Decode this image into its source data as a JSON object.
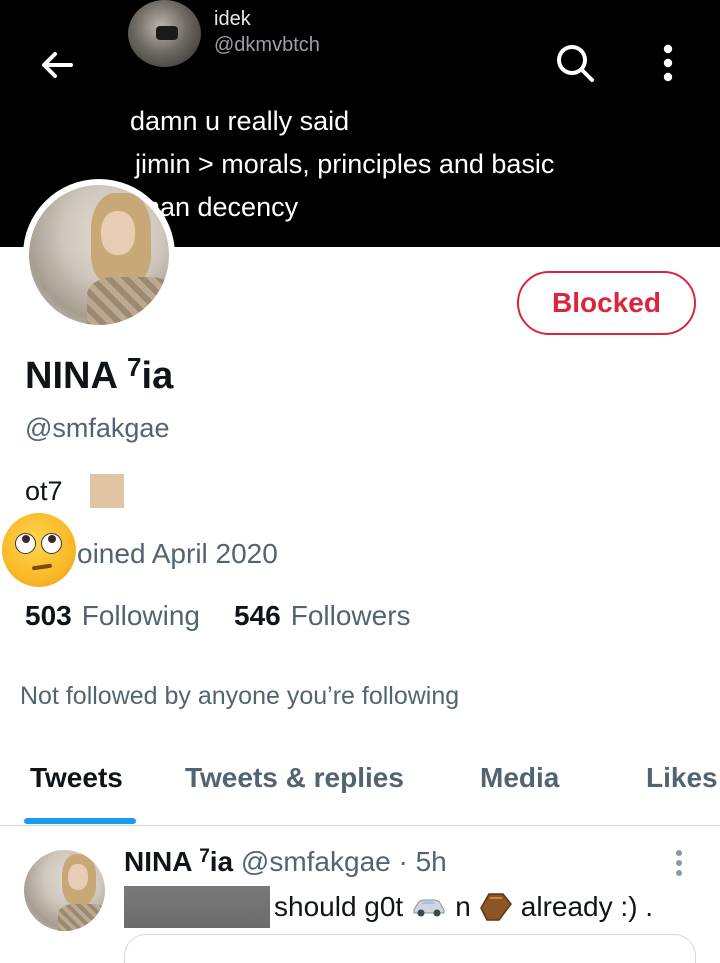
{
  "header": {
    "back_icon": "arrow-left-icon",
    "search_icon": "search-icon",
    "more_icon": "more-vertical-icon"
  },
  "banner": {
    "name": "idek",
    "handle": "@dkmvbtch",
    "text_lines": [
      "damn u really said",
      "jimin > morals, principles and basic",
      "ıman decency"
    ]
  },
  "profile": {
    "blocked_label": "Blocked",
    "display_name": "NINA ",
    "display_name_sup": "7",
    "display_name_suffix": "ia",
    "handle": "@smfakgae",
    "bio": "ot7",
    "joined": "oined April 2020",
    "following_count": "503",
    "following_label": "Following",
    "followers_count": "546",
    "followers_label": "Followers",
    "not_followed_note": "Not followed by anyone you’re following"
  },
  "tabs": [
    {
      "label": "Tweets",
      "active": true
    },
    {
      "label": "Tweets & replies",
      "active": false
    },
    {
      "label": "Media",
      "active": false
    },
    {
      "label": "Likes",
      "active": false
    }
  ],
  "tweet": {
    "name": "NINA ",
    "name_sup": "7",
    "name_suffix": "ia",
    "meta": " @smfakgae · 5h",
    "text_part1": "should g0t",
    "text_part2": "n",
    "text_part3": "already :) ."
  },
  "colors": {
    "banner_bg": "#000000",
    "accent": "#1d9bf0",
    "blocked": "#d7263d",
    "muted_text": "#536471"
  }
}
